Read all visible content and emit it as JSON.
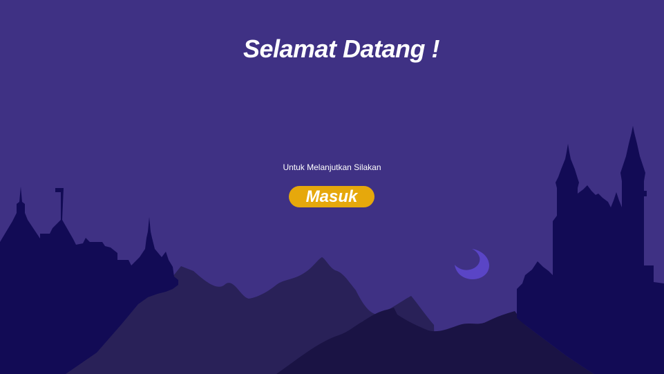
{
  "welcome": {
    "title": "Selamat Datang !",
    "subtitle": "Untuk Melanjutkan Silakan"
  },
  "actions": {
    "login_label": "Masuk"
  },
  "colors": {
    "background": "#3f3184",
    "accent": "#e6a80c",
    "castle_silhouette": "#120b55",
    "mountains_back": "#292158",
    "mountains_front": "#1a1344",
    "moon": "#5a45c6",
    "text": "#ffffff"
  },
  "icons": {
    "moon": "crescent-moon-icon"
  }
}
